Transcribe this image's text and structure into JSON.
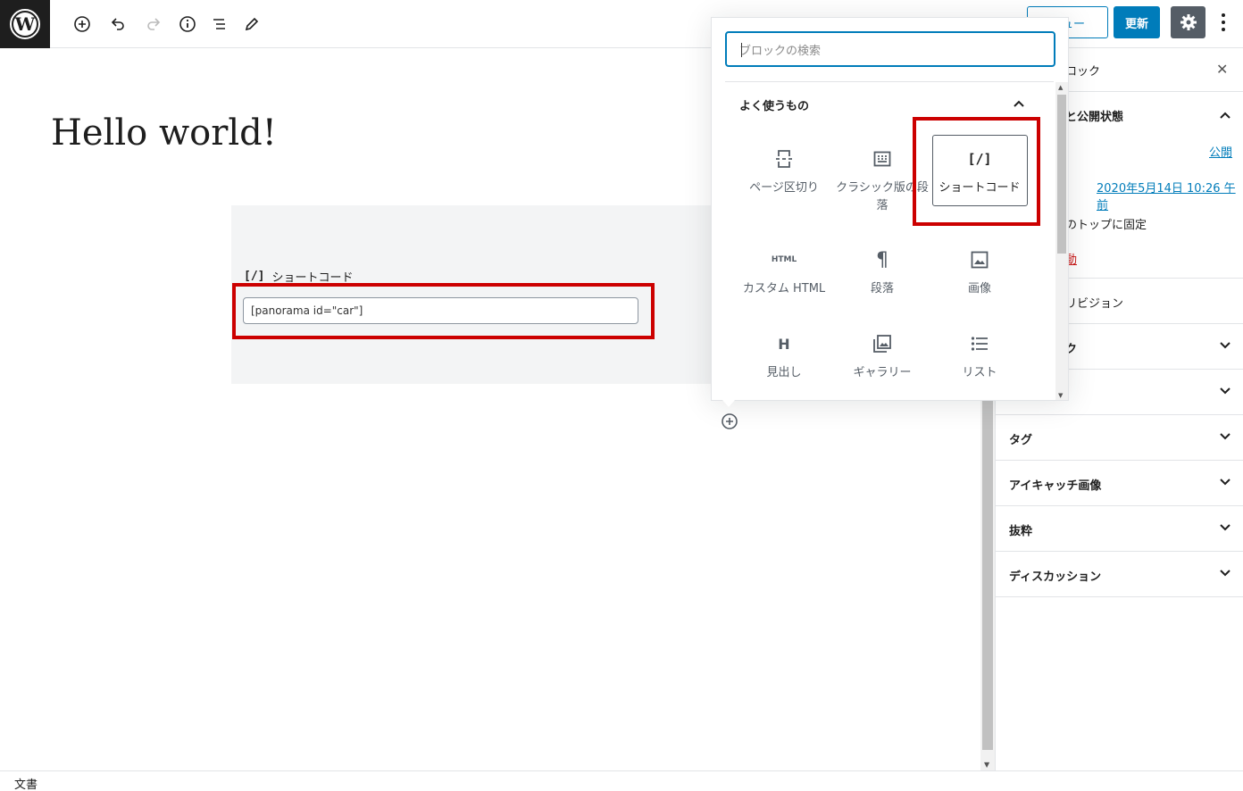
{
  "toolbar": {
    "preview_label": "ビュー",
    "update_label": "更新"
  },
  "editor": {
    "post_title": "Hello world!",
    "shortcode_block": {
      "icon_text": "[/]",
      "label": "ショートコード",
      "value": "[panorama id=\"car\"]"
    }
  },
  "inserter": {
    "search_placeholder": "ブロックの検索",
    "category_title": "よく使うもの",
    "blocks": [
      {
        "label": "ページ区切り",
        "icon": "page-break-icon"
      },
      {
        "label": "クラシック版の段落",
        "icon": "classic-icon"
      },
      {
        "label": "ショートコード",
        "icon": "shortcode-icon",
        "icon_text": "[/]"
      },
      {
        "label": "カスタム HTML",
        "icon": "html-icon",
        "icon_text": "HTML"
      },
      {
        "label": "段落",
        "icon": "paragraph-icon",
        "icon_text": "¶"
      },
      {
        "label": "画像",
        "icon": "image-icon"
      },
      {
        "label": "見出し",
        "icon": "heading-icon",
        "icon_text": "H"
      },
      {
        "label": "ギャラリー",
        "icon": "gallery-icon"
      },
      {
        "label": "リスト",
        "icon": "list-icon"
      }
    ]
  },
  "sidebar": {
    "block_tab": "ロック",
    "status_title": "と公開状態",
    "visibility_value": "公開",
    "publish_value": "2020年5月14日 10:26 午前",
    "sticky_label": "のトップに固定",
    "trash_label": "動",
    "revisions_label": "リビジョン",
    "categories_label": "ク",
    "panels": [
      "タグ",
      "アイキャッチ画像",
      "抜粋",
      "ディスカッション"
    ]
  },
  "footer": {
    "breadcrumb": "文書"
  },
  "colors": {
    "accent": "#007cba",
    "highlight": "#cc0000",
    "dark": "#1e1e1e"
  }
}
